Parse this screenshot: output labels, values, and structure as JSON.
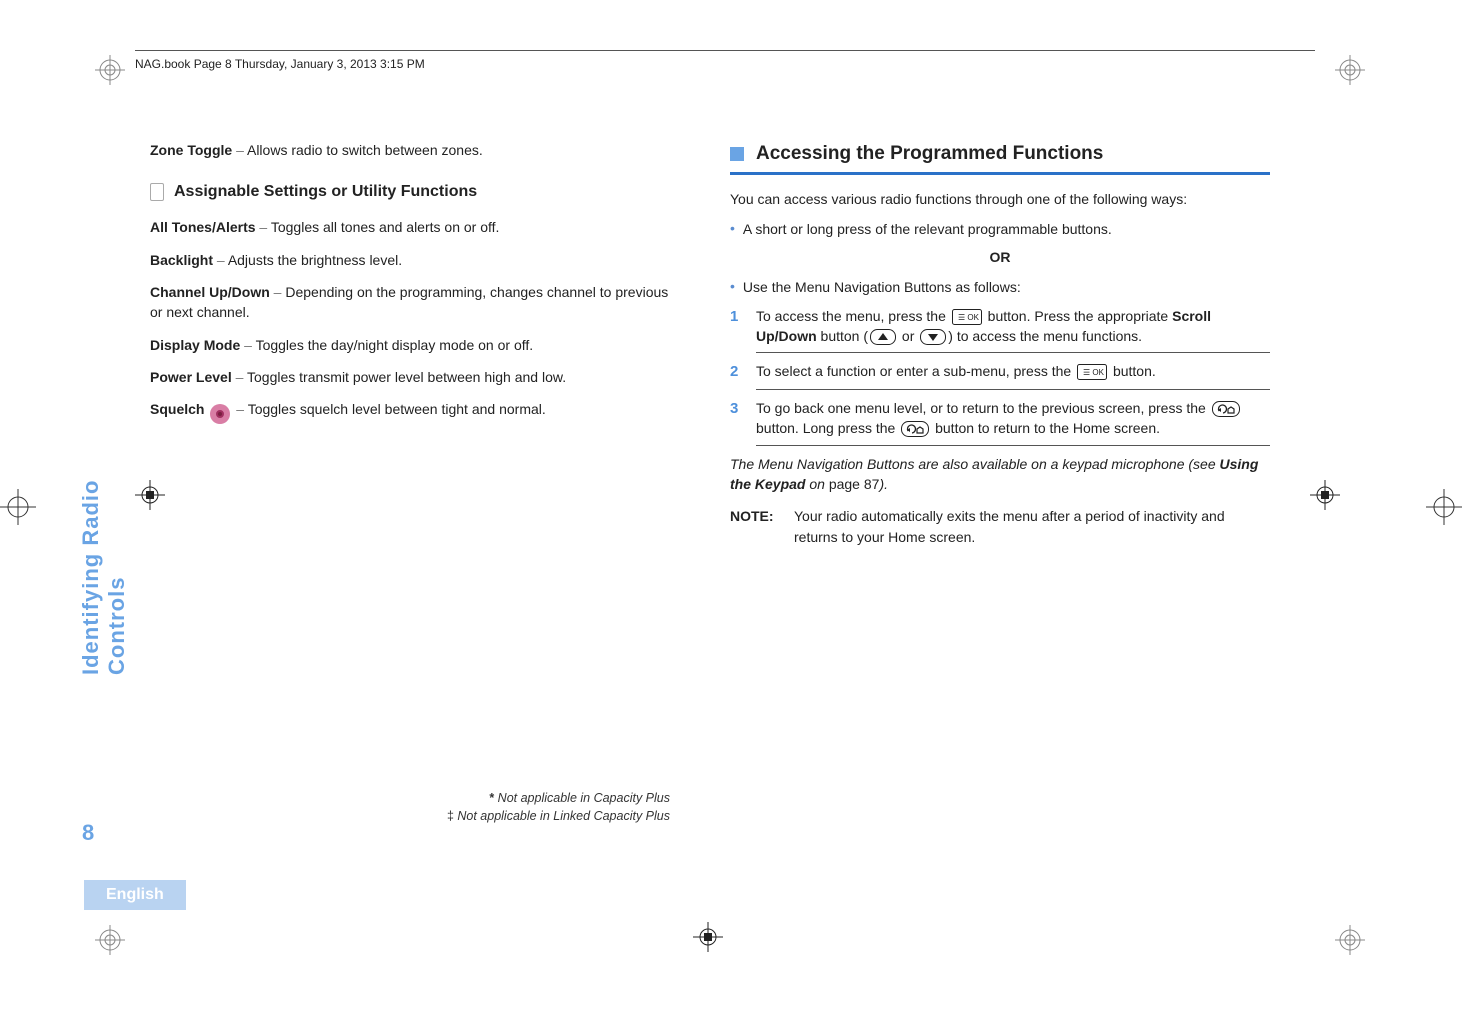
{
  "header": {
    "running": "NAG.book  Page 8  Thursday, January 3, 2013  3:15 PM"
  },
  "sidebar": {
    "chapter": "Identifying Radio Controls",
    "page_number": "8",
    "language": "English"
  },
  "left_column": {
    "zone_toggle": {
      "term": "Zone Toggle",
      "dash": " – ",
      "desc": "Allows radio to switch between zones."
    },
    "subsection_title": "Assignable Settings or Utility Functions",
    "entries": {
      "all_tones": {
        "term": "All Tones/Alerts",
        "dash": " – ",
        "desc": "Toggles all tones and alerts on or off."
      },
      "backlight": {
        "term": "Backlight",
        "dash": " – ",
        "desc": "Adjusts the brightness level."
      },
      "channel_updown": {
        "term": "Channel Up/Down",
        "dash": " – ",
        "desc": "Depending on the programming, changes channel to previous or next channel."
      },
      "display_mode": {
        "term": "Display Mode",
        "dash": " – ",
        "desc": "Toggles the day/night display mode on or off."
      },
      "power_level": {
        "term": "Power Level",
        "dash": " – ",
        "desc": "Toggles transmit power level between high and low."
      },
      "squelch": {
        "term": "Squelch",
        "dash": " – ",
        "desc": "Toggles squelch level between tight and normal."
      }
    }
  },
  "right_column": {
    "section_title": "Accessing the Programmed Functions",
    "intro": "You can access various radio functions through one of the following ways:",
    "bullet1": "A short or long press of the relevant programmable buttons.",
    "or": "OR",
    "bullet2": "Use the Menu Navigation Buttons as follows:",
    "steps": {
      "s1a": "To access the menu, press the ",
      "s1b": " button. Press the appropriate ",
      "s1_scroll": "Scroll Up/Down",
      "s1c": " button (",
      "s1_or": " or ",
      "s1d": ") to access the menu functions.",
      "s2a": "To select a function or enter a sub-menu, press the ",
      "s2b": " button.",
      "s3a": "To go back one menu level, or to return to the previous screen, press the ",
      "s3b": " button. Long press the ",
      "s3c": " button to return to the Home screen."
    },
    "menu_note_a": "The Menu Navigation Buttons are also available on a keypad microphone (see ",
    "menu_note_bold": "Using the Keypad",
    "menu_note_b": " on ",
    "menu_note_page": "page 87",
    "menu_note_c": ").",
    "note_label": "NOTE:",
    "note_body": "Your radio automatically exits the menu after a period of inactivity and returns to your Home screen."
  },
  "footnotes": {
    "f1_mark": "*",
    "f1_text": " Not applicable in Capacity Plus",
    "f2_mark": "‡",
    "f2_text": " Not applicable in Linked Capacity Plus"
  },
  "icons": {
    "ok": "menu-ok-button-icon",
    "up": "scroll-up-button-icon",
    "down": "scroll-down-button-icon",
    "back": "back-home-button-icon"
  }
}
